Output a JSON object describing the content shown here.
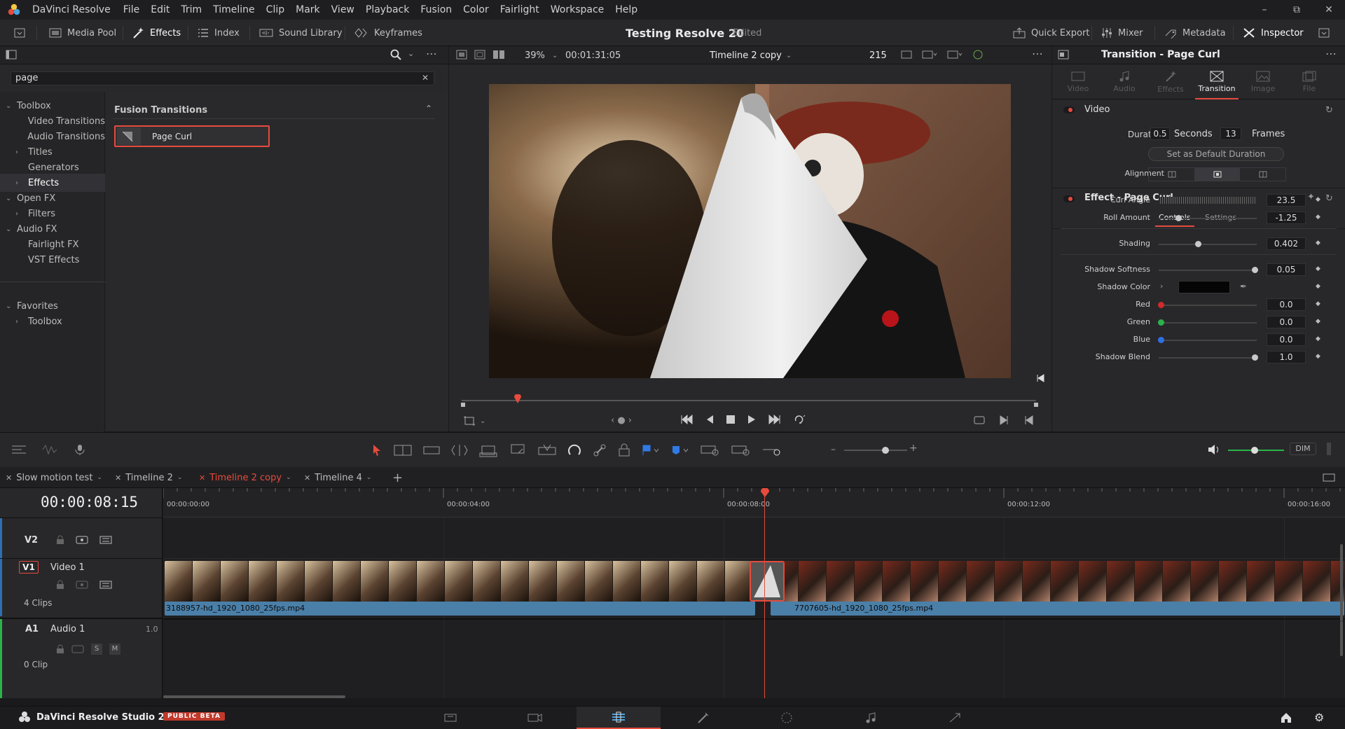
{
  "menubar": {
    "app": "DaVinci Resolve",
    "items": [
      "File",
      "Edit",
      "Trim",
      "Timeline",
      "Clip",
      "Mark",
      "View",
      "Playback",
      "Fusion",
      "Color",
      "Fairlight",
      "Workspace",
      "Help"
    ]
  },
  "toolbar": {
    "media_pool": "Media Pool",
    "effects": "Effects",
    "index": "Index",
    "sound_library": "Sound Library",
    "keyframes": "Keyframes",
    "project_title": "Testing Resolve 20",
    "project_status": "Edited",
    "quick_export": "Quick Export",
    "mixer": "Mixer",
    "metadata": "Metadata",
    "inspector": "Inspector"
  },
  "effects_panel": {
    "search_value": "page",
    "section_title": "Fusion Transitions",
    "result_item": "Page Curl",
    "tree": [
      {
        "label": "Toolbox",
        "level": 0,
        "chev": "down"
      },
      {
        "label": "Video Transitions",
        "level": 1,
        "chev": ""
      },
      {
        "label": "Audio Transitions",
        "level": 1,
        "chev": ""
      },
      {
        "label": "Titles",
        "level": 1,
        "chev": "right"
      },
      {
        "label": "Generators",
        "level": 1,
        "chev": ""
      },
      {
        "label": "Effects",
        "level": 1,
        "chev": "right"
      },
      {
        "label": "Open FX",
        "level": 0,
        "chev": "down"
      },
      {
        "label": "Filters",
        "level": 1,
        "chev": "right"
      },
      {
        "label": "Audio FX",
        "level": 0,
        "chev": "down"
      },
      {
        "label": "Fairlight FX",
        "level": 1,
        "chev": ""
      },
      {
        "label": "VST Effects",
        "level": 1,
        "chev": ""
      }
    ],
    "favorites": [
      {
        "label": "Favorites",
        "level": 0,
        "chev": "down"
      },
      {
        "label": "Toolbox",
        "level": 1,
        "chev": "right"
      }
    ]
  },
  "viewer": {
    "zoom": "39%",
    "timecode": "00:01:31:05",
    "timeline_name": "Timeline 2 copy",
    "frame": "215"
  },
  "inspector": {
    "title": "Transition - Page Curl",
    "tabs": [
      "Video",
      "Audio",
      "Effects",
      "Transition",
      "Image",
      "File"
    ],
    "active_tab": "Transition",
    "video_section": "Video",
    "duration_label": "Duration",
    "duration_seconds": "0.5",
    "seconds_label": "Seconds",
    "duration_frames": "13",
    "frames_label": "Frames",
    "set_default": "Set as Default Duration",
    "alignment_label": "Alignment",
    "effect_section": "Effect - Page Curl",
    "sub_tabs": [
      "Controls",
      "Settings"
    ],
    "params": [
      {
        "label": "Curl Angle",
        "value": "23.5"
      },
      {
        "label": "Roll Amount",
        "value": "-1.25"
      },
      {
        "label": "Shading",
        "value": "0.402"
      },
      {
        "label": "Shadow Softness",
        "value": "0.05"
      },
      {
        "label": "Shadow Color",
        "value": ""
      },
      {
        "label": "Red",
        "value": "0.0"
      },
      {
        "label": "Green",
        "value": "0.0"
      },
      {
        "label": "Blue",
        "value": "0.0"
      },
      {
        "label": "Shadow Blend",
        "value": "1.0"
      }
    ]
  },
  "edit_toolbar": {
    "dim": "DIM"
  },
  "timeline": {
    "tabs": [
      "Slow motion test",
      "Timeline 2",
      "Timeline 2 copy",
      "Timeline 4"
    ],
    "active_tab": "Timeline 2 copy",
    "timecode": "00:00:08:15",
    "ruler": [
      "00:00:00:00",
      "00:00:04:00",
      "00:00:08:00",
      "00:00:12:00",
      "00:00:16:00"
    ],
    "tracks": {
      "v2": "V2",
      "v1": "V1",
      "v1_name": "Video 1",
      "v1_clips": "4 Clips",
      "a1": "A1",
      "a1_name": "Audio 1",
      "a1_level": "1.0",
      "a1_clips": "0 Clip",
      "solo": "S",
      "mute": "M"
    },
    "clip1": "3188957-hd_1920_1080_25fps.mp4",
    "clip2": "7707605-hd_1920_1080_25fps.mp4"
  },
  "bottombar": {
    "product": "DaVinci Resolve Studio 20",
    "badge": "PUBLIC BETA"
  },
  "colors": {
    "accent_red": "#e64b3c",
    "clip_blue": "#4a7fa8"
  }
}
